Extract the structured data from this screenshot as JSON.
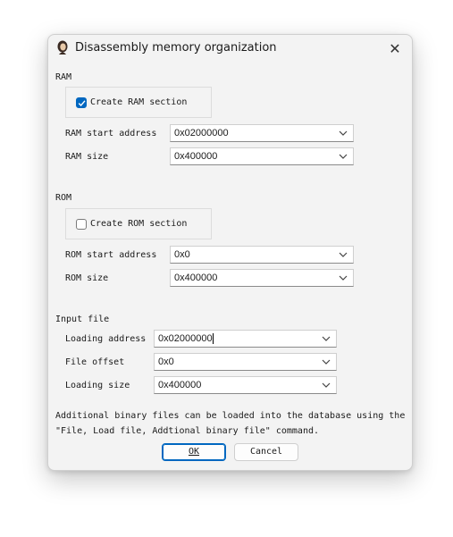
{
  "window": {
    "title": "Disassembly memory organization",
    "close_label": "✕",
    "app_icon": "ida-woman-icon"
  },
  "ram": {
    "group_label": "RAM",
    "create_label": "Create RAM section",
    "create_checked": true,
    "start_label": "RAM start address",
    "start_value": "0x02000000",
    "size_label": "RAM size",
    "size_value": "0x400000"
  },
  "rom": {
    "group_label": "ROM",
    "create_label": "Create ROM section",
    "create_checked": false,
    "start_label": "ROM start address",
    "start_value": "0x0",
    "size_label": "ROM size",
    "size_value": "0x400000"
  },
  "input_file": {
    "group_label": "Input file",
    "loading_address_label": "Loading address",
    "loading_address_value": "0x02000000",
    "file_offset_label": "File offset",
    "file_offset_value": "0x0",
    "loading_size_label": "Loading size",
    "loading_size_value": "0x400000"
  },
  "info": {
    "line1": "Additional binary files can be loaded into the database using the",
    "line2": "\"File, Load file, Addtional binary file\" command."
  },
  "buttons": {
    "ok_label": "OK",
    "cancel_label": "Cancel"
  },
  "colors": {
    "accent": "#0067c0",
    "dialog_bg": "#f3f3f3"
  }
}
